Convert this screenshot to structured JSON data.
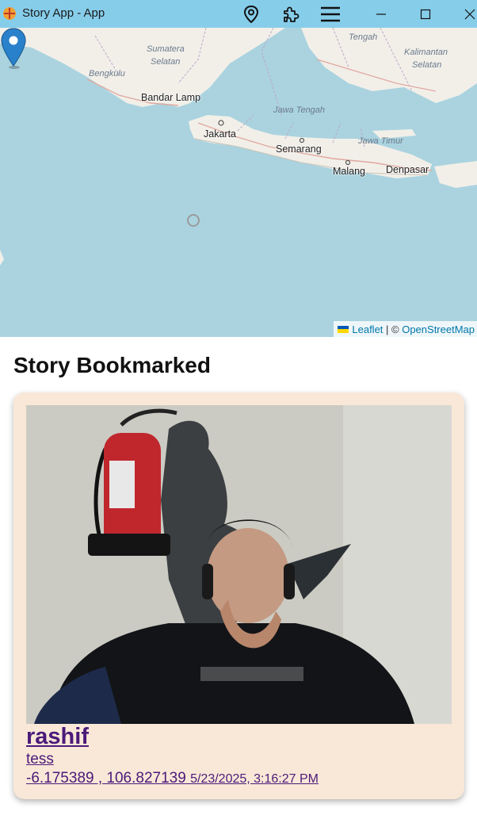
{
  "window": {
    "title": "Story App - App",
    "buttons": [
      "map-pin-icon",
      "puzzle-icon",
      "menu-icon",
      "minimize-icon",
      "maximize-icon",
      "close-icon"
    ]
  },
  "map": {
    "labels": {
      "sumatera_selatan_1": "Sumatera",
      "sumatera_selatan_2": "Selatan",
      "bengkulu": "Bengkulu",
      "bandar_lampung": "Bandar Lamp",
      "jakarta": "Jakarta",
      "jawa_tengah": "Jawa Tengah",
      "semarang": "Semarang",
      "jawa_timur": "Jawa Timur",
      "malang": "Malang",
      "denpasar": "Denpasar",
      "kalimantan_tengah": "Tengah",
      "kalimantan_selatan_1": "Kalimantan",
      "kalimantan_selatan_2": "Selatan"
    },
    "attribution": {
      "leaflet": "Leaflet",
      "separator": " | © ",
      "osm": "OpenStreetMap"
    },
    "colors": {
      "water": "#aad3df",
      "land": "#f2efe9",
      "marker": "#2a81cb"
    }
  },
  "page": {
    "heading": "Story Bookmarked"
  },
  "story": {
    "name": "rashif",
    "description": "tess",
    "coordinates": "-6.175389 , 106.827139",
    "date": "5/23/2025, 3:16:27 PM",
    "card_color": "#f9e8d7",
    "link_color": "#4b1a7a"
  }
}
